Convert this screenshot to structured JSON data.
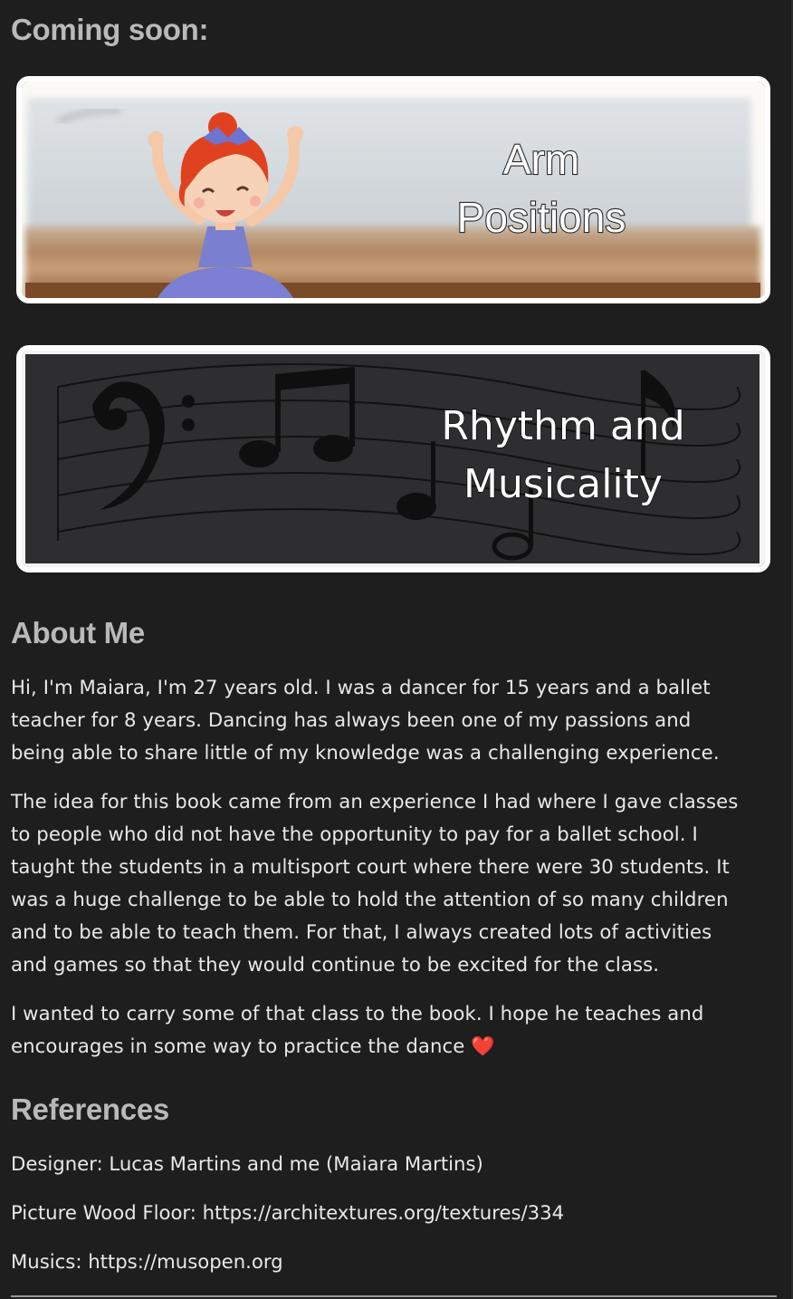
{
  "coming_soon": {
    "title": "Coming soon:"
  },
  "cards": [
    {
      "line1": "Arm",
      "line2": "Positions"
    },
    {
      "line1": "Rhythm and",
      "line2": "Musicality"
    }
  ],
  "about": {
    "title": "About Me",
    "p1": [
      "Hi, I'm Maiara, I'm 27 years old. I was a dancer for 15 years and a ballet",
      "teacher for 8 years. Dancing has always been one of my passions and",
      "being able to share little of my knowledge was a challenging experience."
    ],
    "p2": [
      "The idea for this book came from an experience I had where I gave classes",
      "to people who did not have the opportunity to pay for a ballet school. I",
      "taught the students in a multisport court where there were 30 students. It",
      "was a huge challenge to be able to hold the attention of so many children",
      "and to be able to teach them. For that, I always created lots of activities",
      "and games so that they would continue to be excited for the class."
    ],
    "p3": [
      "I wanted to carry some of that class to the book. I hope he teaches and",
      "encourages in some way to practice the dance ❤️"
    ]
  },
  "references": {
    "title": "References",
    "designer": "Designer: Lucas Martins and me (Maiara Martins)",
    "picture": "Picture Wood Floor: https://architextures.org/textures/334",
    "musics": "Musics:  https://musopen.org"
  },
  "colors": {
    "background": "#1e1e1f",
    "heading": "#b9b9b9",
    "text": "#e8e8e8",
    "card_border": "#ffffff"
  }
}
